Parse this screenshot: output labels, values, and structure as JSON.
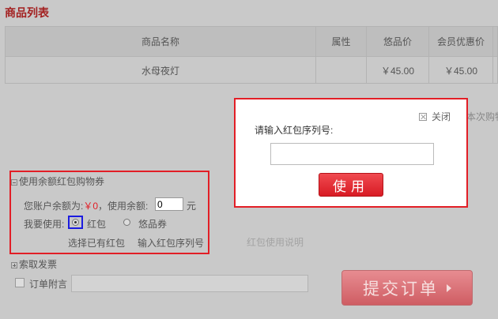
{
  "section_title": "商品列表",
  "table": {
    "headers": [
      "商品名称",
      "属性",
      "悠品价",
      "会员优惠价"
    ],
    "rows": [
      [
        "水母夜灯",
        "",
        "￥45.00",
        "￥45.00"
      ]
    ]
  },
  "payment": {
    "title": "使用余额红包购物券",
    "balance_prefix": "您账户余额为:",
    "balance_value": "￥0",
    "balance_suffix": "，使用余额:",
    "use_balance_value": "0",
    "yuan": "元",
    "use_label": "我要使用:",
    "option_redpacket": "红包",
    "option_coupon": "悠品券",
    "select_existing": "选择已有红包",
    "enter_serial": "输入红包序列号",
    "redpacket_help": "红包使用说明"
  },
  "modal": {
    "close_label": "关闭",
    "prompt": "请输入红包序列号:",
    "input_value": "",
    "use_button": "使用"
  },
  "behind_modal_text": "本次购物",
  "invoice_label": "索取发票",
  "memo_label": "订单附言",
  "memo_value": "",
  "submit_label": "提交订单",
  "colors": {
    "accent_red": "#e21e26",
    "highlight_blue": "#1b1be0"
  }
}
